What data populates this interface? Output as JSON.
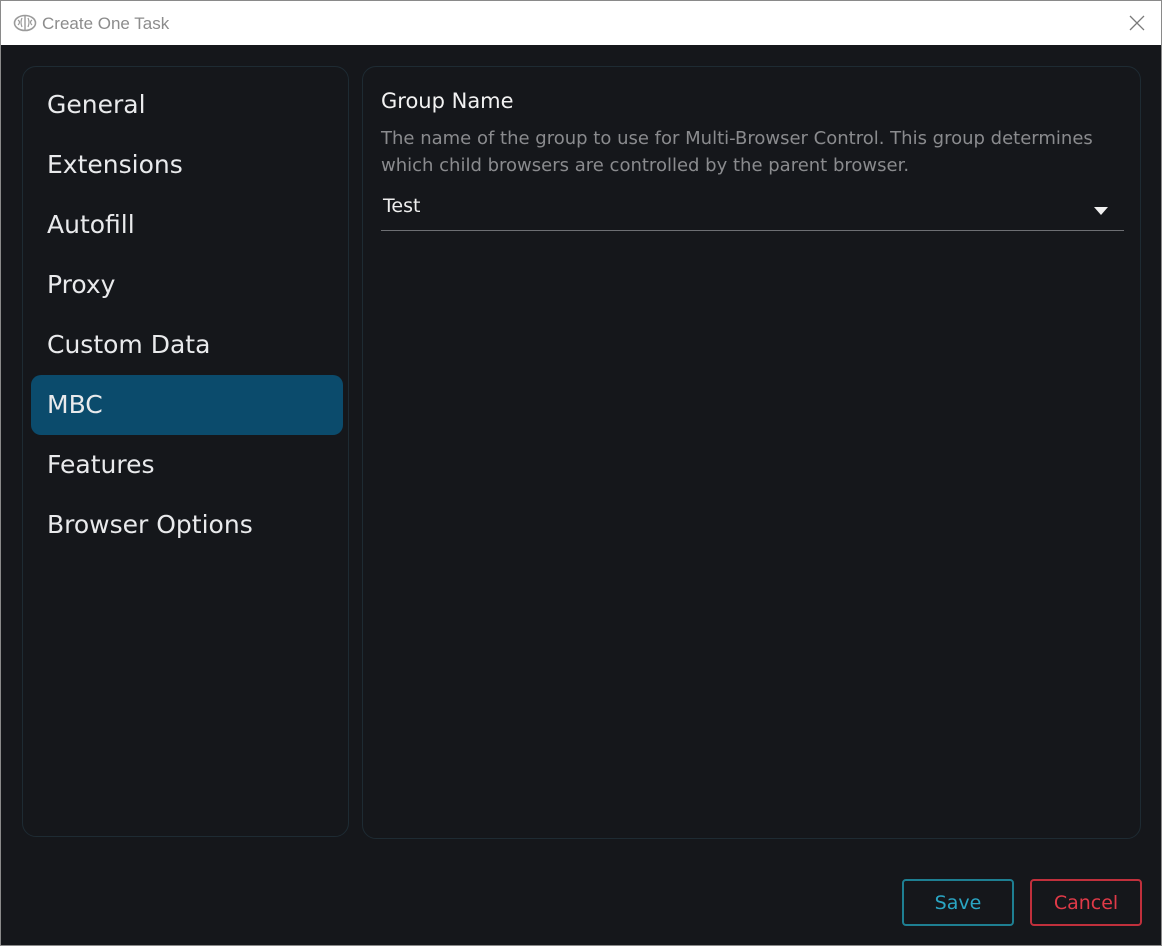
{
  "window": {
    "title": "Create One Task",
    "app_icon": "brain-icon",
    "close_icon": "close-icon"
  },
  "sidebar": {
    "items": [
      {
        "label": "General",
        "active": false
      },
      {
        "label": "Extensions",
        "active": false
      },
      {
        "label": "Autofill",
        "active": false
      },
      {
        "label": "Proxy",
        "active": false
      },
      {
        "label": "Custom Data",
        "active": false
      },
      {
        "label": "MBC",
        "active": true
      },
      {
        "label": "Features",
        "active": false
      },
      {
        "label": "Browser Options",
        "active": false
      }
    ]
  },
  "main": {
    "field_title": "Group Name",
    "field_description": "The name of the group to use for Multi-Browser Control. This group determines which child browsers are controlled by the parent browser.",
    "select_value": "Test",
    "select_icon": "caret-down-icon"
  },
  "footer": {
    "save_label": "Save",
    "cancel_label": "Cancel"
  },
  "colors": {
    "background": "#15171b",
    "active_item": "#0b4b6c",
    "save_accent": "#2aa6c4",
    "cancel_accent": "#e03a48"
  }
}
